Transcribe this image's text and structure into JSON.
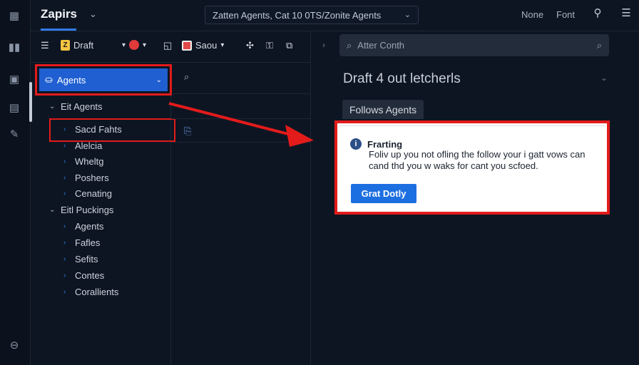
{
  "app": {
    "name": "Zapirs"
  },
  "breadcrumb": "Zatten Agents, Cat 10 0TS/Zonite Agents",
  "topbar": {
    "link_none": "None",
    "link_font": "Font"
  },
  "toolbar": {
    "draft_label": "Draft",
    "save_label": "Saou"
  },
  "sidebar": {
    "selected": "Agents",
    "groups": [
      {
        "label": "Eit Agents",
        "items": [
          "Sacd Fahts",
          "Alelcia",
          "Wheltg",
          "Poshers",
          "Cenating"
        ]
      },
      {
        "label": "Eitl Puckings",
        "items": [
          "Agents",
          "Fafles",
          "Sefits",
          "Contes",
          "Corallients"
        ]
      }
    ]
  },
  "main": {
    "search_placeholder": "Atter Conth",
    "title": "Draft 4 out letcherls",
    "tab_label": "Follows Agents",
    "card": {
      "title": "Frarting",
      "body": "Foliv up you not ofling the follow your i gatt vows can cand thd you w waks for cant you scfoed.",
      "button": "Grat Dotly"
    }
  },
  "colors": {
    "accent": "#1f5fd1",
    "highlight": "#e31b1b",
    "background": "#0d1522"
  }
}
